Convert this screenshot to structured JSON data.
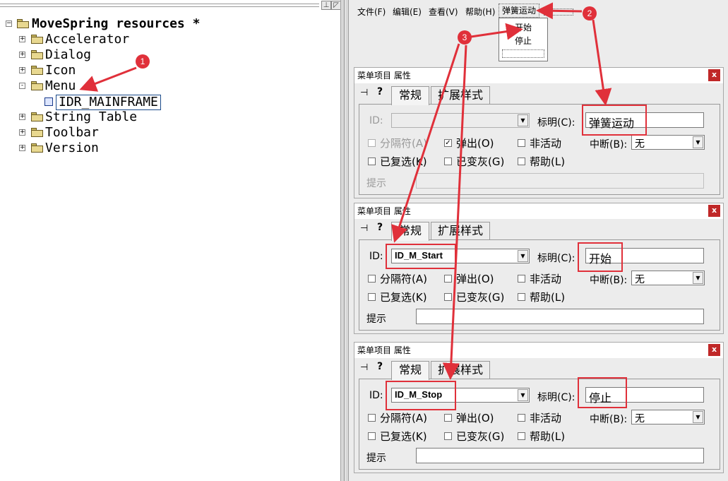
{
  "tree": {
    "root": "MoveSpring resources *",
    "items": [
      {
        "label": "Accelerator",
        "expander": "+"
      },
      {
        "label": "Dialog",
        "expander": "+"
      },
      {
        "label": "Icon",
        "expander": "+"
      },
      {
        "label": "Menu",
        "expander": "-"
      },
      {
        "label": "String Table",
        "expander": "+"
      },
      {
        "label": "Toolbar",
        "expander": "+"
      },
      {
        "label": "Version",
        "expander": "+"
      }
    ],
    "menu_child": "IDR_MAINFRAME"
  },
  "menubar": {
    "items": [
      "文件(F)",
      "编辑(E)",
      "查看(V)",
      "帮助(H)",
      "弹簧运动"
    ]
  },
  "popup": {
    "items": [
      "开始",
      "停止"
    ]
  },
  "dialog_common": {
    "title": "菜单项目 属性",
    "close": "x",
    "tabs": [
      "常规",
      "扩展样式"
    ],
    "id_label": "ID:",
    "caption_label": "标明(C):",
    "separator": "分隔符(A)",
    "popup": "弹出(O)",
    "inactive": "非活动",
    "break_label": "中断(B):",
    "break_value": "无",
    "checked": "已复选(K)",
    "grayed": "已变灰(G)",
    "help": "帮助(L)",
    "prompt": "提示"
  },
  "dialogs": [
    {
      "id_value": "",
      "caption": "弹簧运动",
      "popup_checked": true
    },
    {
      "id_value": "ID_M_Start",
      "caption": "开始",
      "popup_checked": false
    },
    {
      "id_value": "ID_M_Stop",
      "caption": "停止",
      "popup_checked": false
    }
  ],
  "annotations": {
    "badges": [
      "1",
      "2",
      "3"
    ],
    "color": "#e0303a"
  }
}
